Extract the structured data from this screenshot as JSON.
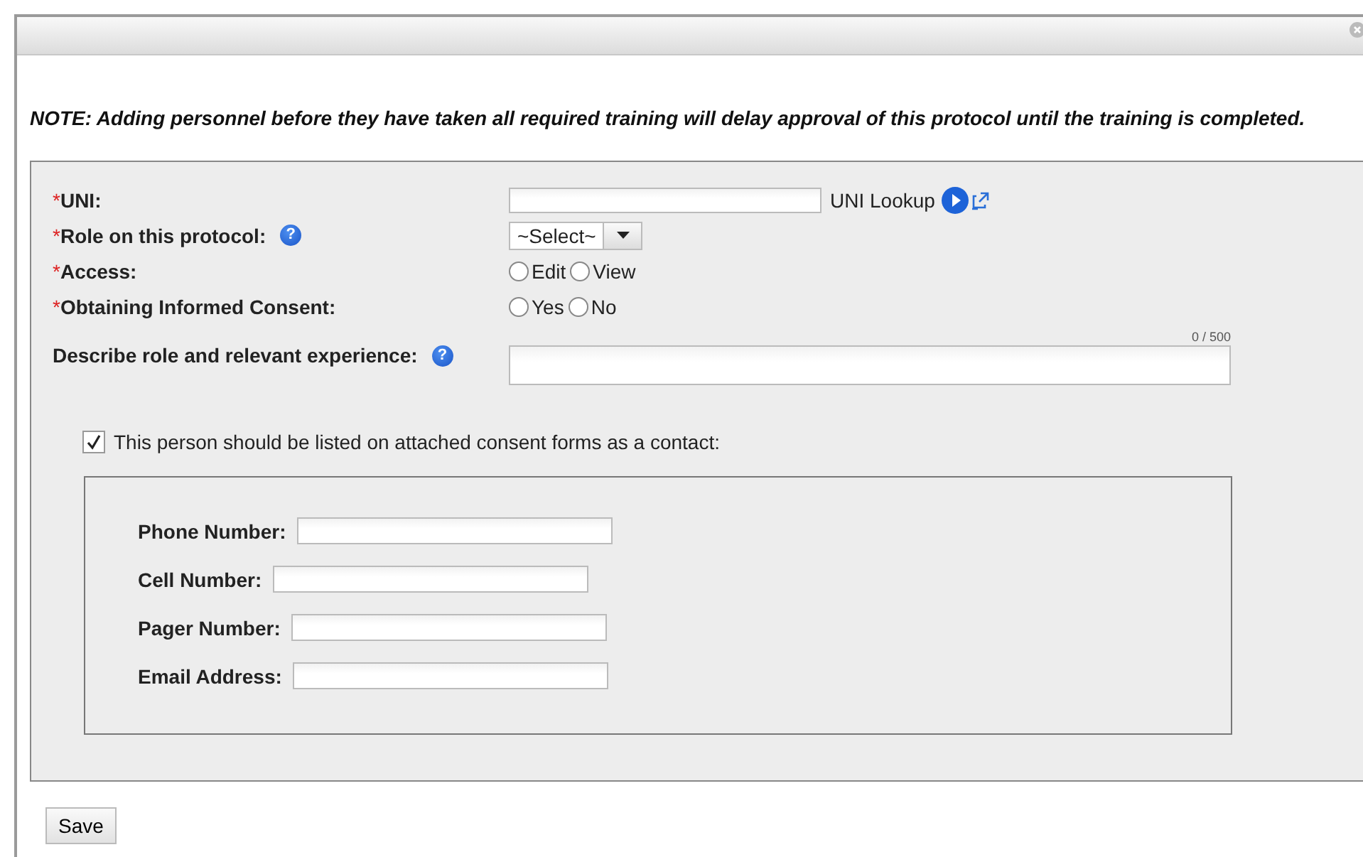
{
  "note": "NOTE: Adding personnel before they have taken all required training will delay approval of this protocol until the training is completed.",
  "fields": [
    {
      "kind": "text",
      "required_mark": "*",
      "label": "UNI:",
      "lookup_label": "UNI Lookup"
    },
    {
      "kind": "select",
      "required_mark": "*",
      "label": "Role on this protocol:",
      "help": "?",
      "value": "~Select~"
    },
    {
      "kind": "radio",
      "required_mark": "*",
      "label": "Access:",
      "options": [
        {
          "label": "Edit",
          "selected": false
        },
        {
          "label": "View",
          "selected": false
        }
      ]
    },
    {
      "kind": "radio",
      "required_mark": "*",
      "label": "Obtaining Informed Consent:",
      "options": [
        {
          "label": "Yes",
          "selected": false
        },
        {
          "label": "No",
          "selected": false
        }
      ]
    },
    {
      "kind": "textarea",
      "label": "Describe role and relevant experience:",
      "help": "?",
      "counter": "0 / 500"
    }
  ],
  "contact": {
    "label": "This person should be listed on attached consent forms as a contact:",
    "checked": true,
    "fields": [
      {
        "label": "Phone Number:"
      },
      {
        "label": "Cell Number:"
      },
      {
        "label": "Pager Number:"
      },
      {
        "label": "Email Address:"
      }
    ]
  },
  "buttons": [
    "Save"
  ]
}
